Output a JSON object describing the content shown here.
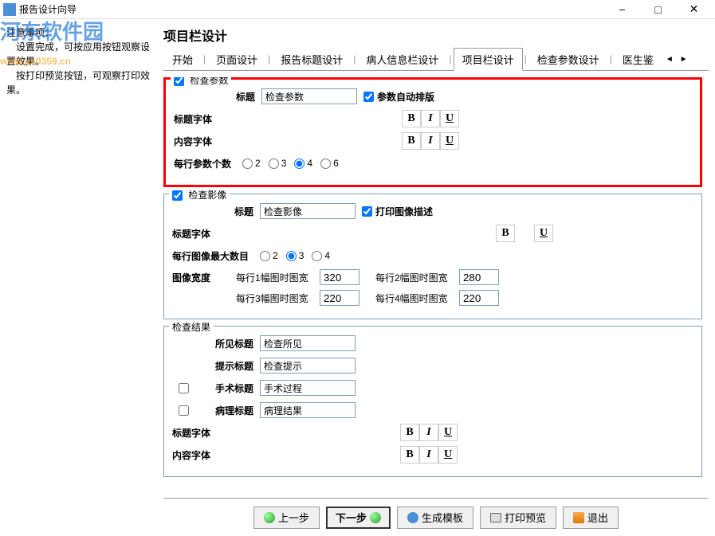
{
  "window": {
    "title": "报告设计向导",
    "minimize": "−",
    "maximize": "□",
    "close": "✕"
  },
  "watermark": {
    "main": "河东软件园",
    "sub": "www.pc0359.cn"
  },
  "leftPanel": {
    "text1": "注意事项：",
    "text2": "　设置完成，可按应用按钮观察设置效果。",
    "text3": "　按打印预览按钮，可观察打印效果。"
  },
  "sectionTitle": "项目栏设计",
  "tabs": {
    "items": [
      "开始",
      "页面设计",
      "报告标题设计",
      "病人信息栏设计",
      "项目栏设计",
      "检查参数设计",
      "医生鉴"
    ],
    "activeIndex": 4,
    "arrowLeft": "◄",
    "arrowRight": "►"
  },
  "checkParams": {
    "groupLabel": "检查参数",
    "titleLabel": "标题",
    "titleValue": "检查参数",
    "autoLayout": "参数自动排版",
    "titleFont": "标题字体",
    "contentFont": "内容字体",
    "perRowLabel": "每行参数个数",
    "perRowOptions": [
      "2",
      "3",
      "4",
      "6"
    ],
    "perRowSelected": "4"
  },
  "checkImage": {
    "groupLabel": "检查影像",
    "titleLabel": "标题",
    "titleValue": "检查影像",
    "printDesc": "打印图像描述",
    "titleFont": "标题字体",
    "maxPerRow": "每行图像最大数目",
    "maxOptions": [
      "2",
      "3",
      "4"
    ],
    "maxSelected": "3",
    "widthLabel": "图像宽度",
    "w1Label": "每行1幅图时图宽",
    "w1Value": "320",
    "w2Label": "每行2幅图时图宽",
    "w2Value": "280",
    "w3Label": "每行3幅图时图宽",
    "w3Value": "220",
    "w4Label": "每行4幅图时图宽",
    "w4Value": "220"
  },
  "checkResult": {
    "groupLabel": "检查结果",
    "seenLabel": "所见标题",
    "seenValue": "检查所见",
    "hintLabel": "提示标题",
    "hintValue": "检查提示",
    "opLabel": "手术标题",
    "opValue": "手术过程",
    "pathLabel": "病理标题",
    "pathValue": "病理结果",
    "titleFont": "标题字体",
    "contentFont": "内容字体"
  },
  "fmt": {
    "b": "B",
    "i": "I",
    "u": "U"
  },
  "buttons": {
    "prev": "上一步",
    "next": "下一步",
    "gen": "生成模板",
    "print": "打印预览",
    "exit": "退出"
  }
}
